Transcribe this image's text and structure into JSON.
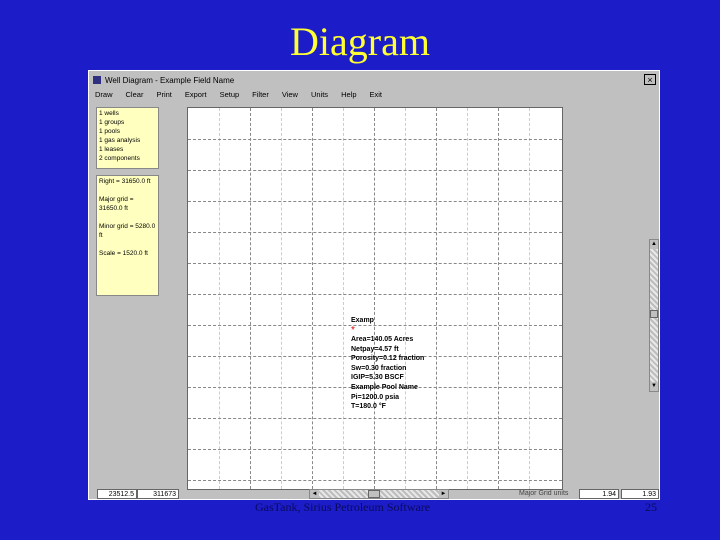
{
  "slide": {
    "title": "Diagram",
    "footer": "GasTank, Sirius Petroleum Software",
    "page_number": "25"
  },
  "window": {
    "title": "Well Diagram - Example Field Name",
    "close_symbol": "×",
    "menu": [
      "Draw",
      "Clear",
      "Print",
      "Export",
      "Setup",
      "Filter",
      "View",
      "Units",
      "Help",
      "Exit"
    ]
  },
  "summary_panel": {
    "lines": [
      "1 wells",
      "1 groups",
      "1 pools",
      "1 gas analysis",
      "1 leases",
      "2 components"
    ]
  },
  "axis_panel": {
    "lines": [
      "Right = 31650.0 ft",
      "Major grid = 31650.0 ft",
      "Minor grid = 5280.0 ft",
      "Scale = 1520.0 ft"
    ]
  },
  "well": {
    "label": "Examp",
    "marker": "*",
    "details": [
      "Area=140.05 Acres",
      "Netpay=4.57 ft",
      "Porosity=0.12 fraction",
      "Sw=0.30 fraction",
      "IGIP=5.30 BSCF",
      "Example Pool Name",
      "Pi=1200.0 psia",
      "T=180.0 °F"
    ]
  },
  "status_bar": {
    "x_value": "23512.5",
    "y_value": "311673",
    "label": "Major Grid units",
    "value1": "1.94",
    "value2": "1.93"
  }
}
